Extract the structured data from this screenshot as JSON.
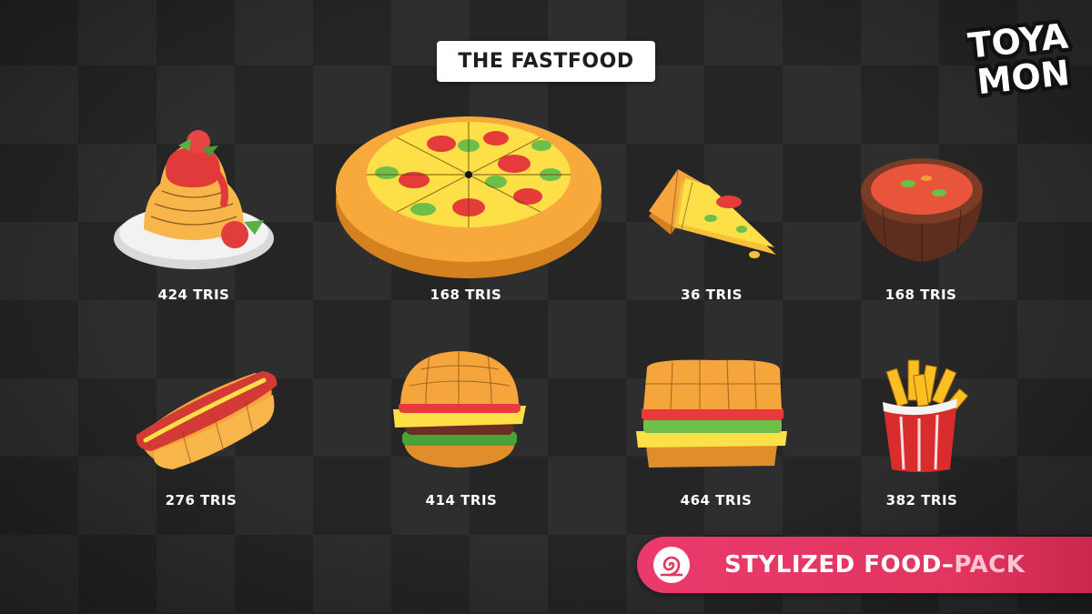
{
  "header": {
    "title": "THE FASTFOOD"
  },
  "logo": {
    "line1": "TOYA",
    "line2": "MON",
    "icon": "toyamon-logo"
  },
  "items": [
    {
      "id": "spaghetti",
      "icon": "spaghetti-plate-icon",
      "tris": "424 TRIS"
    },
    {
      "id": "pizza",
      "icon": "pizza-icon",
      "tris": "168 TRIS"
    },
    {
      "id": "pizza-slice",
      "icon": "pizza-slice-icon",
      "tris": "36 TRIS"
    },
    {
      "id": "soup",
      "icon": "soup-bowl-icon",
      "tris": "168 TRIS"
    },
    {
      "id": "hotdog",
      "icon": "hotdog-icon",
      "tris": "276 TRIS"
    },
    {
      "id": "burger",
      "icon": "burger-icon",
      "tris": "414 TRIS"
    },
    {
      "id": "sandwich",
      "icon": "sandwich-icon",
      "tris": "464 TRIS"
    },
    {
      "id": "fries",
      "icon": "fries-icon",
      "tris": "382 TRIS"
    }
  ],
  "footer": {
    "pack_main": "STYLIZED FOOD",
    "pack_separator": "–",
    "pack_accent": "PACK",
    "icon": "snail-shell-icon"
  },
  "colors": {
    "banner_pink": "#e2355f",
    "cheese": "#fde047",
    "sauce": "#e83b3b",
    "crust": "#f5a53b",
    "pepper": "#6cc04a"
  }
}
